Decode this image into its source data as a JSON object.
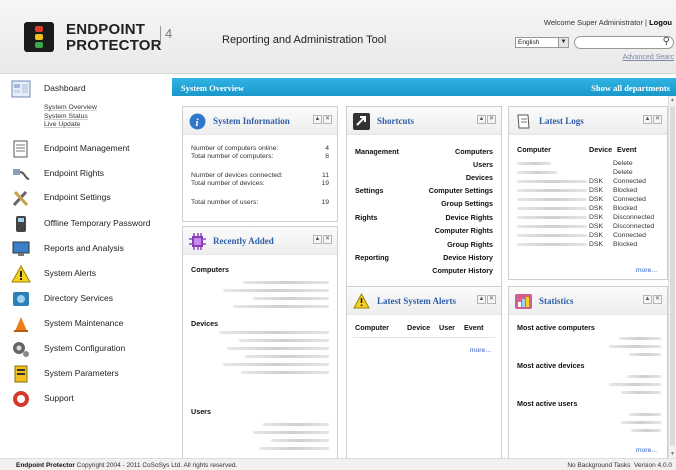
{
  "header": {
    "brand_line1": "ENDPOINT",
    "brand_line2": "PROTECTOR",
    "brand_version": "4",
    "tool_title": "Reporting and Administration Tool",
    "welcome": "Welcome Super Administrator",
    "logout": "Logou",
    "language": "English",
    "search_value": "",
    "advanced_search": "Advanced Searc"
  },
  "sidebar": {
    "dashboard": "Dashboard",
    "sub_items": [
      "System Overview",
      "System Status",
      "Live Update"
    ],
    "items": [
      {
        "label": "Endpoint Management",
        "icon": "endpoint-management-icon"
      },
      {
        "label": "Endpoint Rights",
        "icon": "endpoint-rights-icon"
      },
      {
        "label": "Endpoint Settings",
        "icon": "endpoint-settings-icon"
      },
      {
        "label": "Offline Temporary Password",
        "icon": "offline-password-icon"
      },
      {
        "label": "Reports and Analysis",
        "icon": "reports-icon"
      },
      {
        "label": "System Alerts",
        "icon": "system-alerts-icon"
      },
      {
        "label": "Directory Services",
        "icon": "directory-services-icon"
      },
      {
        "label": "System Maintenance",
        "icon": "system-maintenance-icon"
      },
      {
        "label": "System Configuration",
        "icon": "system-configuration-icon"
      },
      {
        "label": "System Parameters",
        "icon": "system-parameters-icon"
      },
      {
        "label": "Support",
        "icon": "support-icon"
      }
    ]
  },
  "overview": {
    "title": "System Overview",
    "show_all": "Show all departments"
  },
  "system_information": {
    "title": "System Information",
    "rows": [
      {
        "label": "Number of computers online:",
        "value": "4"
      },
      {
        "label": "Total number of computers:",
        "value": "8"
      },
      {
        "label": "Number of devices connected:",
        "value": "11"
      },
      {
        "label": "Total number of devices:",
        "value": "19"
      },
      {
        "label": "Total number of users:",
        "value": "19"
      }
    ]
  },
  "recently_added": {
    "title": "Recently Added",
    "sections": [
      "Computers",
      "Devices",
      "Users"
    ]
  },
  "shortcuts": {
    "title": "Shortcuts",
    "groups": [
      {
        "label": "Management",
        "links": [
          "Computers",
          "Users",
          "Devices"
        ]
      },
      {
        "label": "Settings",
        "links": [
          "Computer Settings",
          "Group Settings"
        ]
      },
      {
        "label": "Rights",
        "links": [
          "Device Rights",
          "Computer Rights",
          "Group Rights"
        ]
      },
      {
        "label": "Reporting",
        "links": [
          "Device History",
          "Computer History"
        ]
      }
    ]
  },
  "latest_alerts": {
    "title": "Latest System Alerts",
    "columns": [
      "Computer",
      "Device",
      "User",
      "Event"
    ],
    "more": "more..."
  },
  "latest_logs": {
    "title": "Latest Logs",
    "columns": [
      "Computer",
      "Device",
      "Event"
    ],
    "rows": [
      {
        "device": "",
        "event": "Delete"
      },
      {
        "device": "",
        "event": "Delete"
      },
      {
        "device": "DSK",
        "event": "Connected"
      },
      {
        "device": "DSK",
        "event": "Blocked"
      },
      {
        "device": "DSK",
        "event": "Connected"
      },
      {
        "device": "DSK",
        "event": "Blocked"
      },
      {
        "device": "DSK",
        "event": "Disconnected"
      },
      {
        "device": "DSK",
        "event": "Disconnected"
      },
      {
        "device": "DSK",
        "event": "Connected"
      },
      {
        "device": "DSK",
        "event": "Blocked"
      }
    ],
    "more": "more..."
  },
  "statistics": {
    "title": "Statistics",
    "sections": [
      "Most active computers",
      "Most active devices",
      "Most active users"
    ],
    "more": "more..."
  },
  "footer": {
    "brand": "Endpoint Protector",
    "copyright": "Copyright 2004 - 2011 CoSoSys Ltd. All rights reserved.",
    "status": "No Background Tasks",
    "version": "Version 4.0.0"
  },
  "colors": {
    "accent_blue": "#1a97c8",
    "panel_title": "#2f5fa8",
    "link": "#3060c0"
  }
}
